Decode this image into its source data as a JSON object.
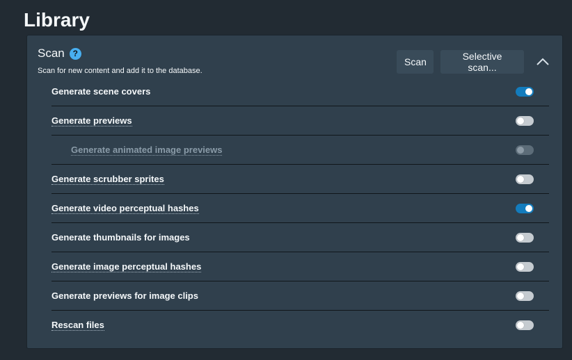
{
  "page": {
    "title": "Library"
  },
  "scan_section": {
    "title": "Scan",
    "help_icon": "?",
    "description": "Scan for new content and add it to the database.",
    "scan_button": "Scan",
    "selective_scan_button": "Selective scan...",
    "collapse_icon": "chevron-up-icon"
  },
  "options": [
    {
      "label": "Generate scene covers",
      "enabled": true,
      "disabled": false,
      "indent": false,
      "has_tooltip": false
    },
    {
      "label": "Generate previews",
      "enabled": false,
      "disabled": false,
      "indent": false,
      "has_tooltip": true
    },
    {
      "label": "Generate animated image previews",
      "enabled": false,
      "disabled": true,
      "indent": true,
      "has_tooltip": true
    },
    {
      "label": "Generate scrubber sprites",
      "enabled": false,
      "disabled": false,
      "indent": false,
      "has_tooltip": true
    },
    {
      "label": "Generate video perceptual hashes",
      "enabled": true,
      "disabled": false,
      "indent": false,
      "has_tooltip": true
    },
    {
      "label": "Generate thumbnails for images",
      "enabled": false,
      "disabled": false,
      "indent": false,
      "has_tooltip": false
    },
    {
      "label": "Generate image perceptual hashes",
      "enabled": false,
      "disabled": false,
      "indent": false,
      "has_tooltip": true
    },
    {
      "label": "Generate previews for image clips",
      "enabled": false,
      "disabled": false,
      "indent": false,
      "has_tooltip": false
    },
    {
      "label": "Rescan files",
      "enabled": false,
      "disabled": false,
      "indent": false,
      "has_tooltip": true
    }
  ],
  "colors": {
    "background": "#222b33",
    "panel": "#30404d",
    "accent": "#137cbd",
    "help_icon": "#48aff0"
  }
}
